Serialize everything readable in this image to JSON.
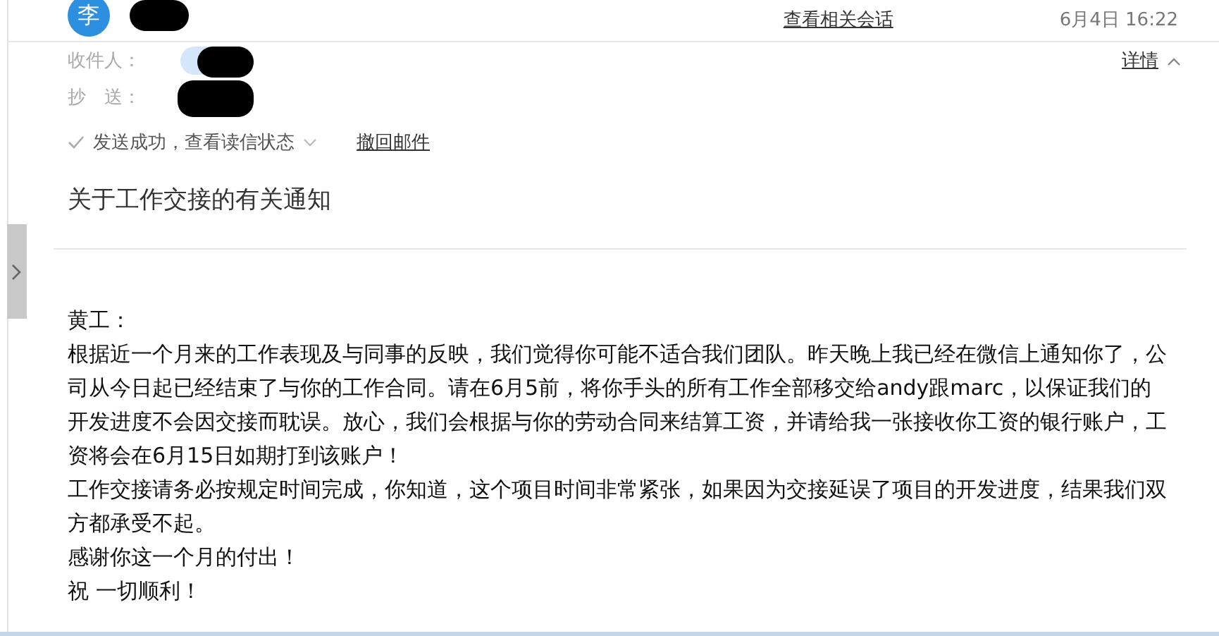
{
  "header": {
    "avatar": "李",
    "sender_redacted": true,
    "related_link": "查看相关会话",
    "time": "6月4日 16:22"
  },
  "details": {
    "to_label": "收件人：",
    "cc_label": "抄　送：",
    "details_link": "详情",
    "status": "发送成功，查看读信状态",
    "recall_link": "撤回邮件"
  },
  "subject": "关于工作交接的有关通知",
  "body": [
    "黄工：",
    "根据近一个月来的工作表现及与同事的反映，我们觉得你可能不适合我们团队。昨天晚上我已经在微信上通知你了，公司从今日起已经结束了与你的工作合同。请在6月5前，将你手头的所有工作全部移交给andy跟marc，以保证我们的开发进度不会因交接而耽误。放心，我们会根据与你的劳动合同来结算工资，并请给我一张接收你工资的银行账户，工资将会在6月15日如期打到该账户！",
    "工作交接请务必按规定时间完成，你知道，这个项目时间非常紧张，如果因为交接延误了项目的开发进度，结果我们双方都承受不起。",
    "感谢你这一个月的付出！",
    "祝 一切顺利！"
  ]
}
